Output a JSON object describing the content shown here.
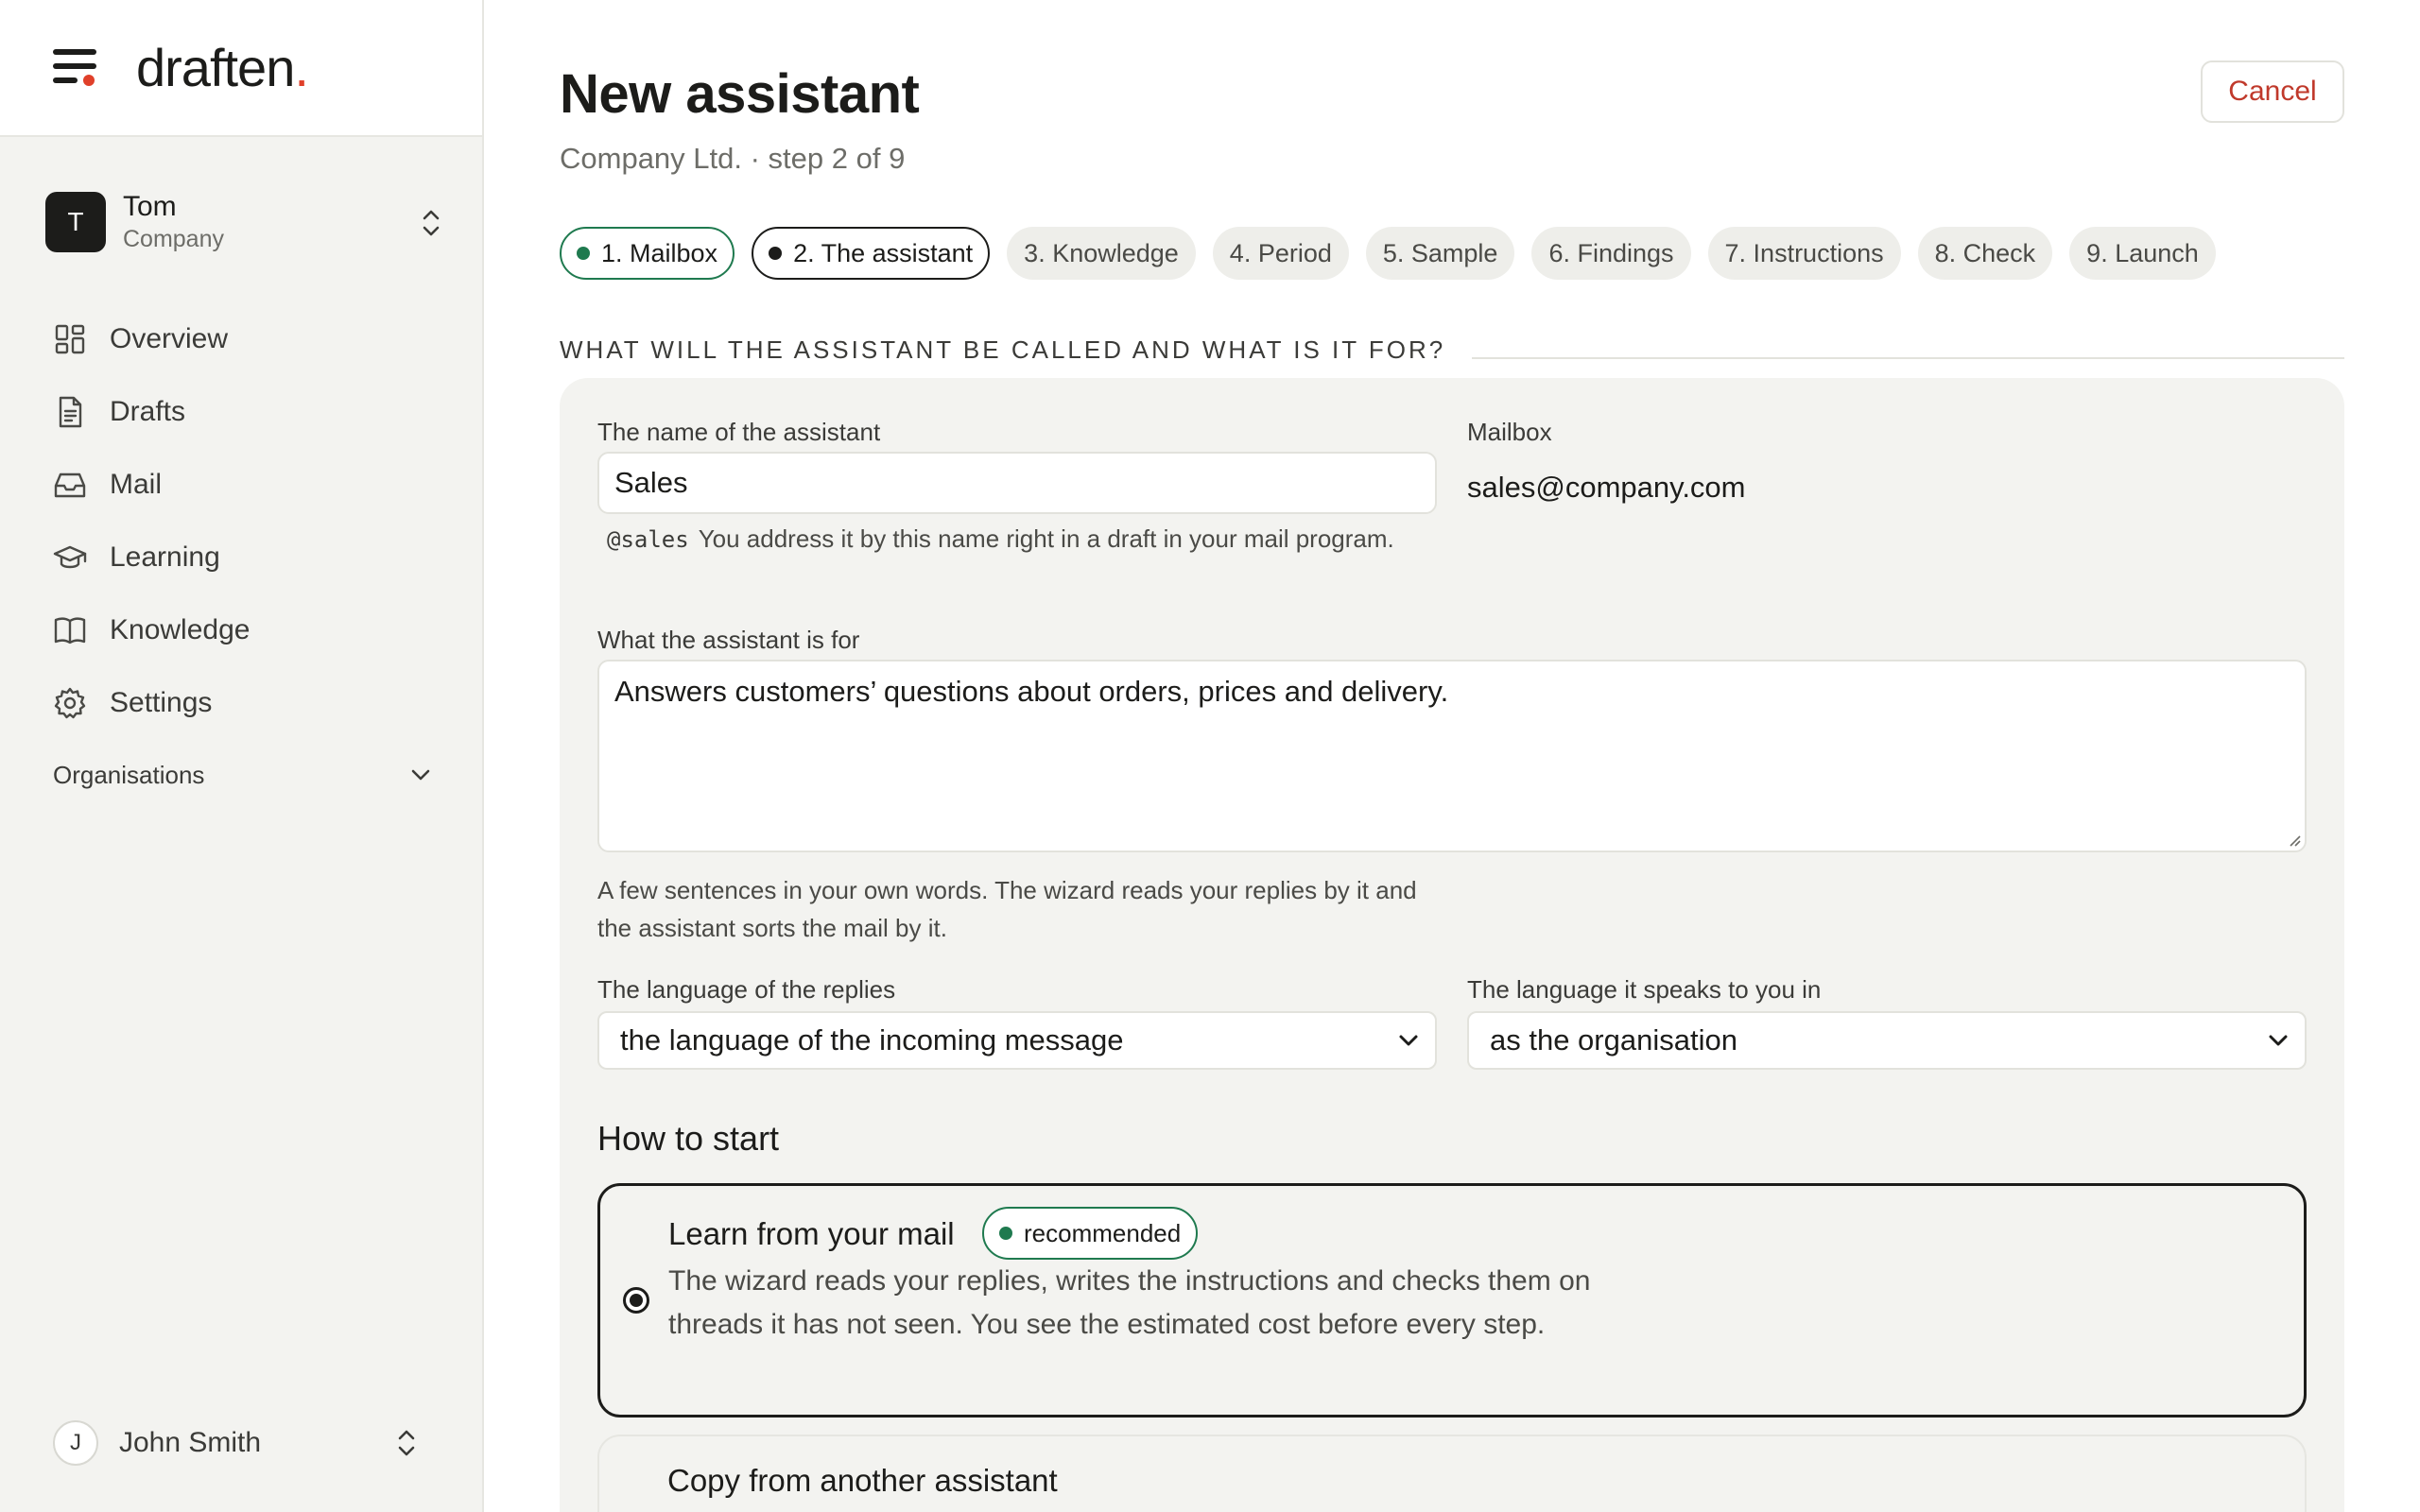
{
  "brand": {
    "logo_text": "draften",
    "logo_dot": ".",
    "accent": "#e0402a"
  },
  "account": {
    "initial": "T",
    "name": "Tom",
    "org": "Company"
  },
  "nav": [
    {
      "label": "Overview",
      "icon": "grid-icon"
    },
    {
      "label": "Drafts",
      "icon": "document-icon"
    },
    {
      "label": "Mail",
      "icon": "inbox-icon"
    },
    {
      "label": "Learning",
      "icon": "graduation-cap-icon"
    },
    {
      "label": "Knowledge",
      "icon": "book-icon"
    },
    {
      "label": "Settings",
      "icon": "gear-icon"
    }
  ],
  "organisations_label": "Organisations",
  "user": {
    "initial": "J",
    "name": "John Smith"
  },
  "page": {
    "title": "New assistant",
    "subtitle": "Company Ltd. · step 2 of 9",
    "cancel_label": "Cancel"
  },
  "steps": [
    {
      "label": "1. Mailbox",
      "state": "done"
    },
    {
      "label": "2. The assistant",
      "state": "current"
    },
    {
      "label": "3. Knowledge",
      "state": "pending"
    },
    {
      "label": "4. Period",
      "state": "pending"
    },
    {
      "label": "5. Sample",
      "state": "pending"
    },
    {
      "label": "6. Findings",
      "state": "pending"
    },
    {
      "label": "7. Instructions",
      "state": "pending"
    },
    {
      "label": "8. Check",
      "state": "pending"
    },
    {
      "label": "9. Launch",
      "state": "pending"
    }
  ],
  "section_title": "WHAT WILL THE ASSISTANT BE CALLED AND WHAT IS IT FOR?",
  "form": {
    "name_label": "The name of the assistant",
    "name_value": "Sales",
    "handle": "@sales",
    "name_hint": "You address it by this name right in a draft in your mail program.",
    "mailbox_label": "Mailbox",
    "mailbox_value": "sales@company.com",
    "purpose_label": "What the assistant is for",
    "purpose_value": "Answers customers’ questions about orders, prices and delivery.",
    "purpose_hint": "A few sentences in your own words. The wizard reads your replies by it and the assistant sorts the mail by it.",
    "reply_lang_label": "The language of the replies",
    "reply_lang_value": "the language of the incoming message",
    "speak_lang_label": "The language it speaks to you in",
    "speak_lang_value": "as the organisation"
  },
  "how_to_start": {
    "heading": "How to start",
    "options": [
      {
        "title": "Learn from your mail",
        "badge": "recommended",
        "description": "The wizard reads your replies, writes the instructions and checks them on threads it has not seen. You see the estimated cost before every step.",
        "selected": true
      },
      {
        "title": "Copy from another assistant",
        "selected": false
      }
    ]
  },
  "colors": {
    "success": "#1f7a4f",
    "danger": "#c0392b",
    "surface": "#f3f3f0"
  }
}
